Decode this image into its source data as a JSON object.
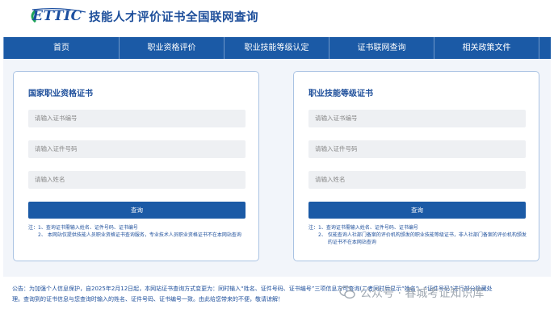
{
  "header": {
    "logo_text": "ETTIC",
    "title": "技能人才评价证书全国联网查询"
  },
  "nav": {
    "items": [
      {
        "label": "首页",
        "width": 144
      },
      {
        "label": "职业资格评价",
        "width": 130
      },
      {
        "label": "职业技能等级认定",
        "width": 130
      },
      {
        "label": "证书联网查询",
        "width": 130
      },
      {
        "label": "相关政策文件",
        "width": 130
      }
    ]
  },
  "left_card": {
    "title": "国家职业资格证书",
    "placeholders": [
      "请输入证书编号",
      "请输入证件号码",
      "请输入姓名"
    ],
    "button": "查询",
    "notes": [
      {
        "prefix": "注：1、",
        "text": "查询证书需输入姓名、证件号码、证书编号"
      },
      {
        "prefix": "2、",
        "text": "本网站仅提供技能人员职业资格证书查询服务，专业技术人员职业资格证书不在本网站查询"
      }
    ]
  },
  "right_card": {
    "title": "职业技能等级证书",
    "placeholders": [
      "请输入证书编号",
      "请输入证件号码",
      "请输入姓名"
    ],
    "button": "查询",
    "notes": [
      {
        "prefix": "注：1、",
        "text": "查询证书需输入姓名、证件号码、证书编号"
      },
      {
        "prefix": "2、",
        "text": "仅能查询人社部门备案的评价机构颁发的职业技能等级证书，非人社部门备案的评价机构颁发的证书不在本网站查询"
      }
    ]
  },
  "notice": {
    "line1": "公告：为加强个人信息保护，自2025年2月12日起，本网站证书查询方式变更为：同时输入“姓名、证件号码、证书编号”三项信息方可查询(二者同时后显示“姓名”、“证件号码”进行部分隐藏处",
    "line2": "理。查询到的证书信息与您查询时输入的姓名、证件号码、证书编号一致。由此给您带来的不便，敬请谅解！"
  },
  "watermark": {
    "text": "公众号 · 春城考证知识库"
  },
  "colors": {
    "brand_blue": "#1b5aa6",
    "title_blue": "#1e4f9b",
    "card_border": "#aac3e3",
    "field_bg": "#eef0f3"
  }
}
